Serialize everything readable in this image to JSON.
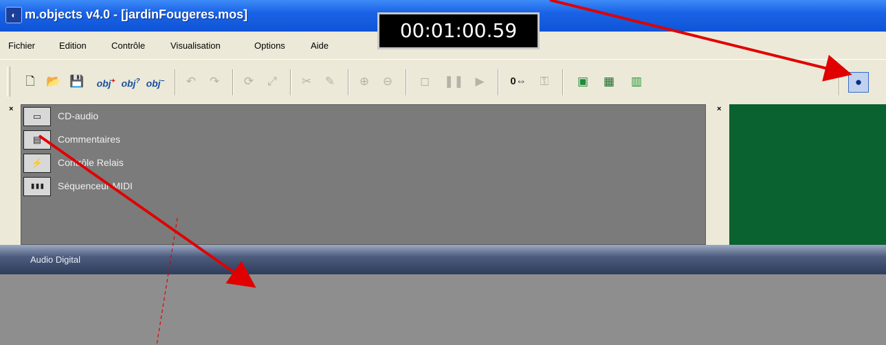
{
  "window": {
    "title": "m.objects v4.0 - [jardinFougeres.mos]",
    "icon": "app-logo-icon"
  },
  "timecode": "00:01:00.59",
  "menu": [
    "Fichier",
    "Edition",
    "Contrôle",
    "Visualisation",
    "Options",
    "Aide"
  ],
  "toolbar": {
    "counter_label": "0",
    "obj_add": "obj",
    "obj_query": "obj",
    "obj_remove": "obj"
  },
  "tool_panel": {
    "items": [
      {
        "label": "CD-audio",
        "icon": "cd-audio-icon"
      },
      {
        "label": "Commentaires",
        "icon": "commentaires-icon"
      },
      {
        "label": "Contrôle Relais",
        "icon": "relay-control-icon"
      },
      {
        "label": "Séquenceur MIDI",
        "icon": "midi-keyboard-icon"
      }
    ]
  },
  "bottom_panel": {
    "title": "Audio Digital"
  },
  "colors": {
    "titlebar": "#0f54d6",
    "preview": "#0a6231",
    "annotation": "#e00000"
  }
}
